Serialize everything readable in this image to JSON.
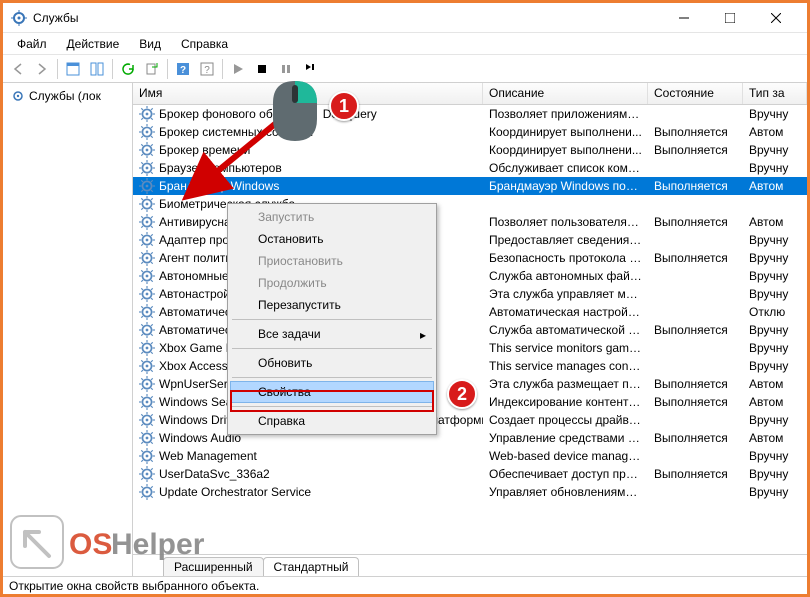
{
  "window": {
    "title": "Службы"
  },
  "menu": {
    "file": "Файл",
    "action": "Действие",
    "view": "Вид",
    "help": "Справка"
  },
  "tree": {
    "root": "Службы (лок"
  },
  "columns": {
    "name": "Имя",
    "description": "Описание",
    "state": "Состояние",
    "startup": "Тип за"
  },
  "services": [
    {
      "name": "Брокер фонового об",
      "name_tail": "DevQuery",
      "desc": "Позволяет приложениям о...",
      "state": "",
      "type": "Вручну"
    },
    {
      "name": "Брокер системных событий",
      "desc": "Координирует выполнени...",
      "state": "Выполняется",
      "type": "Автом"
    },
    {
      "name": "Брокер времени",
      "desc": "Координирует выполнени...",
      "state": "Выполняется",
      "type": "Вручну"
    },
    {
      "name": "Браузер компьютеров",
      "desc": "Обслуживает список комп...",
      "state": "",
      "type": "Вручну"
    },
    {
      "name": "Брандмауэр Windows",
      "desc": "Брандмауэр Windows пом...",
      "state": "Выполняется",
      "type": "Автом",
      "selected": true
    },
    {
      "name": "Биометрическая служба",
      "desc": "",
      "state": "",
      "type": ""
    },
    {
      "name": "Антивирусная программа",
      "desc": "Позволяет пользователям ...",
      "state": "Выполняется",
      "type": "Автом"
    },
    {
      "name": "Адаптер производительности",
      "desc": "Предоставляет сведения б...",
      "state": "",
      "type": "Вручну"
    },
    {
      "name": "Агент политики IPsec",
      "desc": "Безопасность протокола I...",
      "state": "Выполняется",
      "type": "Вручну"
    },
    {
      "name": "Автономные файлы",
      "desc": "Служба автономных файл...",
      "state": "",
      "type": "Вручну"
    },
    {
      "name": "Автонастройка WWAN",
      "desc": "Эта служба управляет моб...",
      "state": "",
      "type": "Вручну"
    },
    {
      "name": "Автоматическое обновление",
      "desc": "Автоматическая настройк...",
      "state": "",
      "type": "Отклю"
    },
    {
      "name": "Автоматическая настройка",
      "desc": "Служба автоматической у...",
      "state": "Выполняется",
      "type": "Вручну"
    },
    {
      "name": "Xbox Game Monitoring",
      "desc": "This service monitors games.",
      "state": "",
      "type": "Вручну"
    },
    {
      "name": "Xbox Accessory Management",
      "desc": "This service manages conne...",
      "state": "",
      "type": "Вручну"
    },
    {
      "name": "WpnUserService_336a2",
      "desc": "Эта служба размещает пла...",
      "state": "Выполняется",
      "type": "Автом"
    },
    {
      "name": "Windows Search",
      "desc": "Индексирование контента,...",
      "state": "Выполняется",
      "type": "Автом"
    },
    {
      "name": "Windows Driver Foundation - среда выполнения платформы д...",
      "desc": "Создает процессы драйвер...",
      "state": "",
      "type": "Вручну"
    },
    {
      "name": "Windows Audio",
      "desc": "Управление средствами р...",
      "state": "Выполняется",
      "type": "Автом"
    },
    {
      "name": "Web Management",
      "desc": "Web-based device manage...",
      "state": "",
      "type": "Вручну"
    },
    {
      "name": "UserDataSvc_336a2",
      "desc": "Обеспечивает доступ прил...",
      "state": "Выполняется",
      "type": "Вручну"
    },
    {
      "name": "Update Orchestrator Service",
      "desc": "Управляет обновлениями ...",
      "state": "",
      "type": "Вручну"
    }
  ],
  "context_menu": {
    "start": "Запустить",
    "stop": "Остановить",
    "pause": "Приостановить",
    "resume": "Продолжить",
    "restart": "Перезапустить",
    "all_tasks": "Все задачи",
    "refresh": "Обновить",
    "properties": "Свойства",
    "help": "Справка"
  },
  "tabs": {
    "extended": "Расширенный",
    "standard": "Стандартный"
  },
  "statusbar": "Открытие окна свойств выбранного объекта.",
  "annotations": {
    "one": "1",
    "two": "2"
  },
  "watermark": {
    "brand1": "OS",
    "brand2": "Helper"
  }
}
